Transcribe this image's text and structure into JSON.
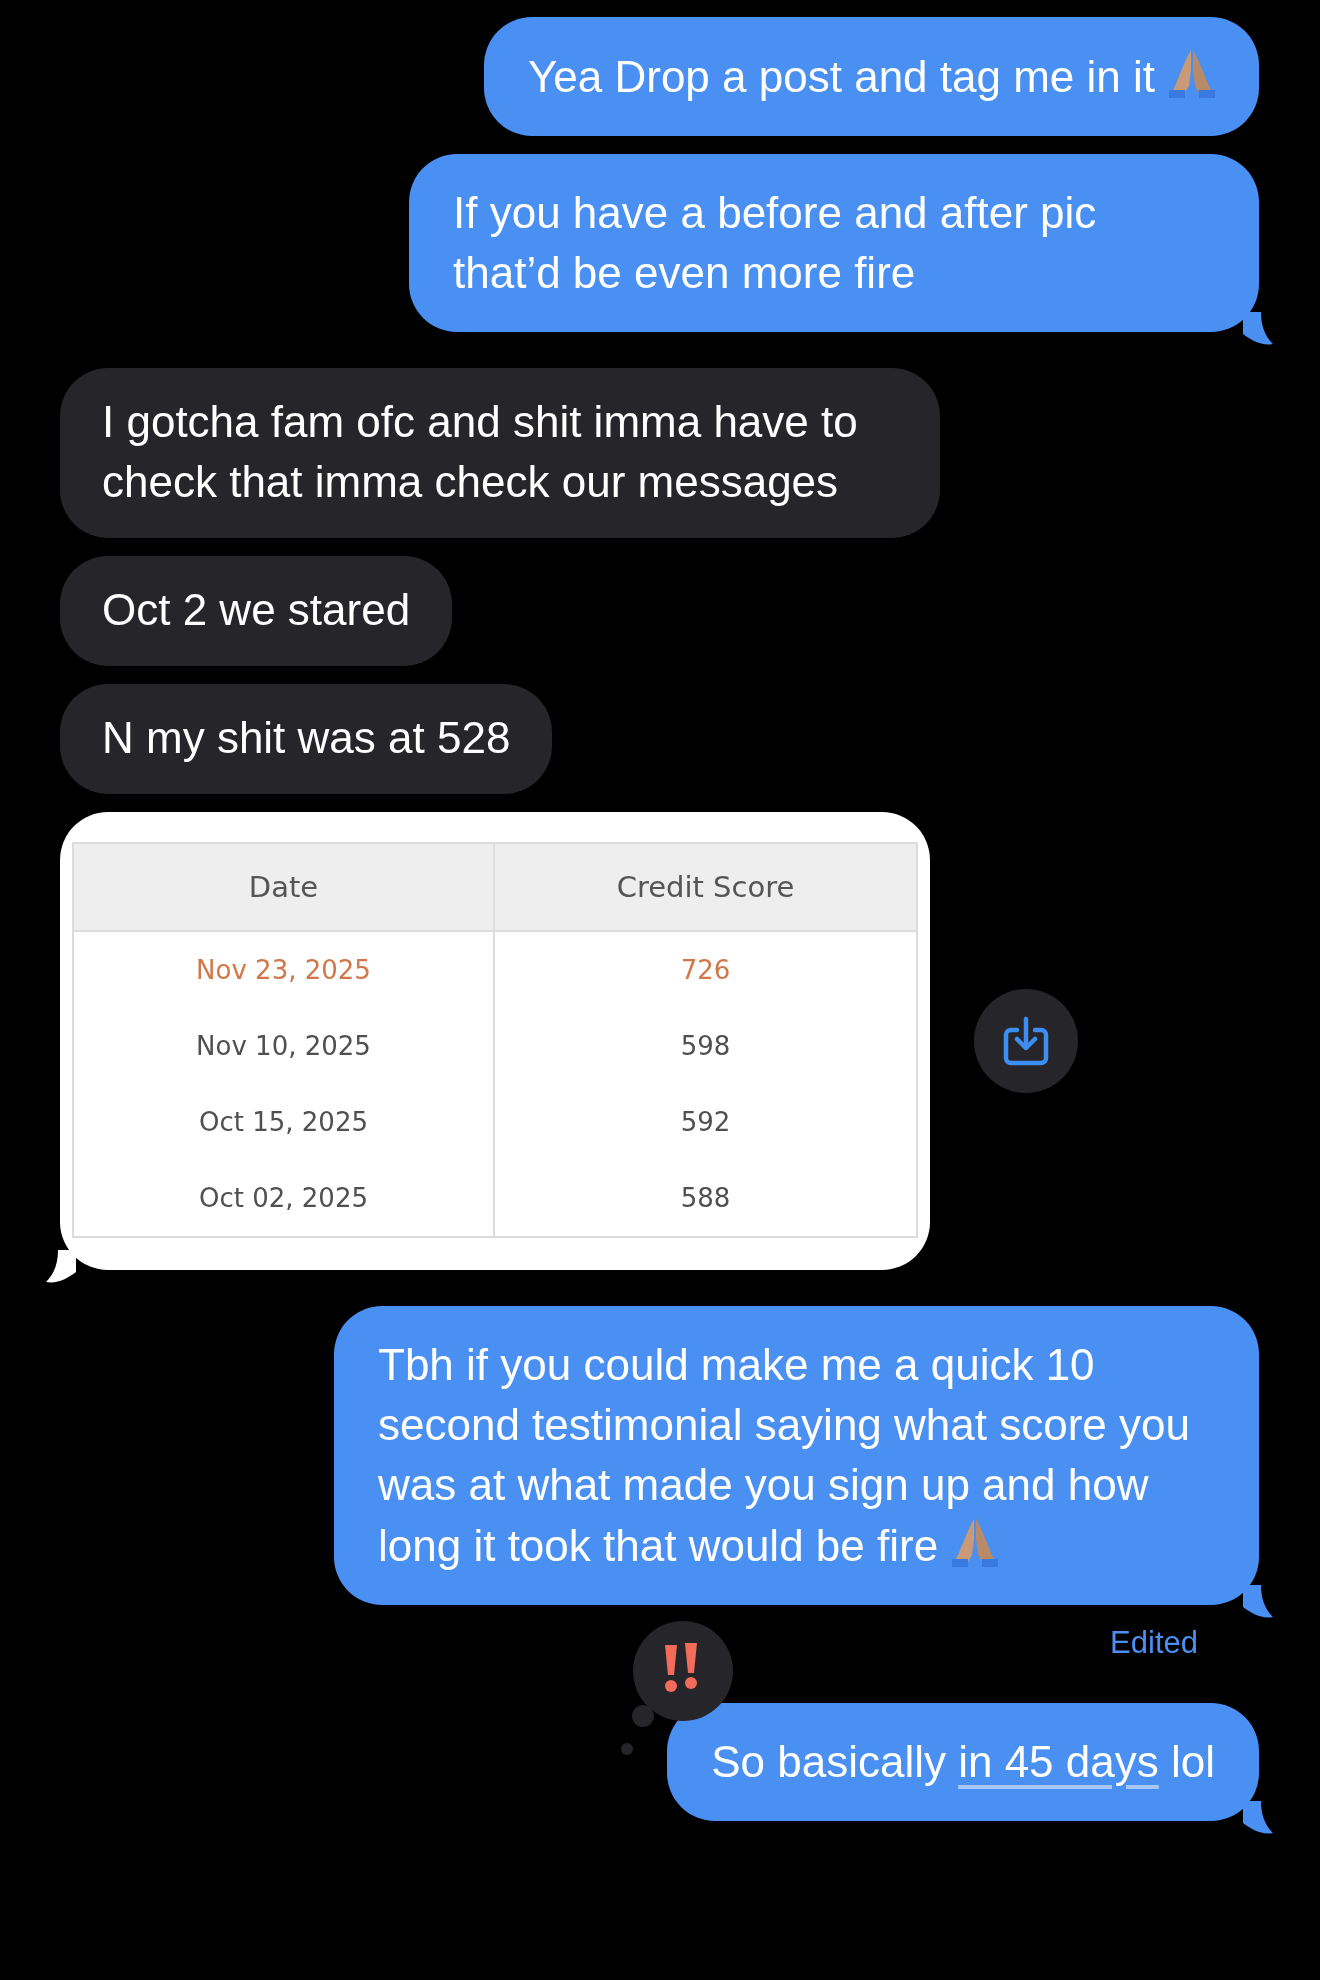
{
  "messages": [
    {
      "kind": "text",
      "from_me": true,
      "tail": false,
      "praying_hands": true,
      "segments": [
        {
          "text": "Yea Drop a post and tag me in it",
          "link": false
        }
      ]
    },
    {
      "kind": "text",
      "from_me": true,
      "tail": true,
      "segments": [
        {
          "text": "If you have a before and after pic that’d be even more fire",
          "link": false
        }
      ]
    },
    {
      "kind": "text",
      "from_me": false,
      "tail": false,
      "segments": [
        {
          "text": "I gotcha fam ofc and shit imma have to check that imma check our messages",
          "link": false
        }
      ]
    },
    {
      "kind": "text",
      "from_me": false,
      "tail": false,
      "segments": [
        {
          "text": "Oct 2 we stared",
          "link": false
        }
      ]
    },
    {
      "kind": "text",
      "from_me": false,
      "tail": false,
      "segments": [
        {
          "text": "N my shit was at 528",
          "link": false
        }
      ]
    },
    {
      "kind": "table",
      "from_me": false,
      "tail": true,
      "save_button": true,
      "columns": [
        "Date",
        "Credit Score"
      ],
      "rows": [
        {
          "cells": [
            "Nov 23, 2025",
            "726"
          ],
          "highlighted": true
        },
        {
          "cells": [
            "Nov 10, 2025",
            "598"
          ],
          "highlighted": false
        },
        {
          "cells": [
            "Oct 15, 2025",
            "592"
          ],
          "highlighted": false
        },
        {
          "cells": [
            "Oct 02, 2025",
            "588"
          ],
          "highlighted": false
        }
      ]
    },
    {
      "kind": "text",
      "from_me": true,
      "tail": true,
      "praying_hands": true,
      "segments": [
        {
          "text": "Tbh if you could make me a quick 10 second testimonial saying what score you was at what made you sign up and how long it took that would be fire",
          "link": false
        }
      ],
      "status": "Edited"
    },
    {
      "kind": "text",
      "from_me": true,
      "tail": true,
      "reacted": true,
      "segments": [
        {
          "text": "So basically ",
          "link": false
        },
        {
          "text": "in 45 days",
          "link": true
        },
        {
          "text": " lol",
          "link": false
        }
      ]
    }
  ]
}
